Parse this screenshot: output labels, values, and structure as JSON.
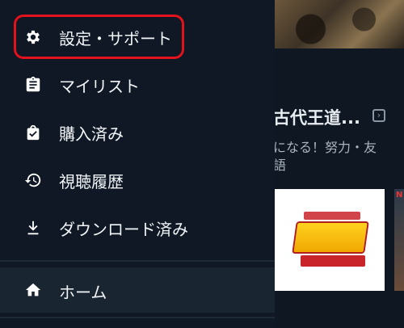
{
  "drawer": {
    "items": [
      {
        "label": "設定・サポート",
        "icon": "gear-icon"
      },
      {
        "label": "マイリスト",
        "icon": "clipboard-icon"
      },
      {
        "label": "購入済み",
        "icon": "shopping-bag-check-icon"
      },
      {
        "label": "視聴履歴",
        "icon": "history-icon"
      },
      {
        "label": "ダウンロード済み",
        "icon": "download-icon"
      }
    ],
    "home": {
      "label": "ホーム",
      "icon": "home-icon"
    }
  },
  "background": {
    "title": "古代王道...",
    "description": [
      "になる！努力・友",
      "語"
    ]
  },
  "colors": {
    "drawer_bg": "#0f1824",
    "highlight": "#e3121c",
    "home_bg": "#1a2532"
  }
}
